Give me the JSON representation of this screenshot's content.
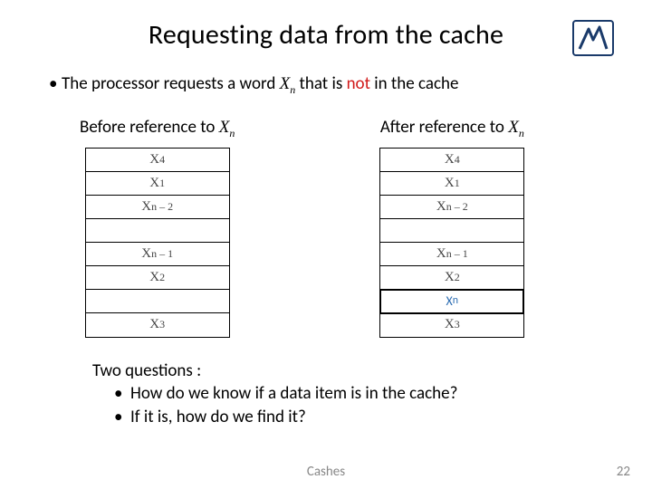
{
  "title": "Requesting data from the cache",
  "lead": {
    "prefix": "The processor requests a word ",
    "word_base": "X",
    "word_sub": "n",
    "mid": " that is ",
    "not": "not",
    "suffix": " in the cache"
  },
  "columns": {
    "before": {
      "label_prefix": "Before reference to ",
      "label_base": "X",
      "label_sub": "n",
      "rows": [
        {
          "base": "X",
          "sub": "4"
        },
        {
          "base": "X",
          "sub": "1"
        },
        {
          "base": "X",
          "sub": "n – 2"
        },
        {
          "base": "",
          "sub": ""
        },
        {
          "base": "X",
          "sub": "n – 1"
        },
        {
          "base": "X",
          "sub": "2"
        },
        {
          "base": "",
          "sub": ""
        },
        {
          "base": "X",
          "sub": "3"
        }
      ]
    },
    "after": {
      "label_prefix": "After reference to ",
      "label_base": "X",
      "label_sub": "n",
      "rows": [
        {
          "base": "X",
          "sub": "4"
        },
        {
          "base": "X",
          "sub": "1"
        },
        {
          "base": "X",
          "sub": "n – 2"
        },
        {
          "base": "",
          "sub": ""
        },
        {
          "base": "X",
          "sub": "n – 1"
        },
        {
          "base": "X",
          "sub": "2"
        },
        {
          "base": "X",
          "sub": "n",
          "highlight": true
        },
        {
          "base": "X",
          "sub": "3"
        }
      ]
    }
  },
  "questions": {
    "intro": "Two questions :",
    "items": [
      "How do we know if a data item is in the cache?",
      "If it is, how do we find it?"
    ]
  },
  "footer": {
    "label": "Cashes",
    "page": "22"
  },
  "logo_name": "technion-logo"
}
